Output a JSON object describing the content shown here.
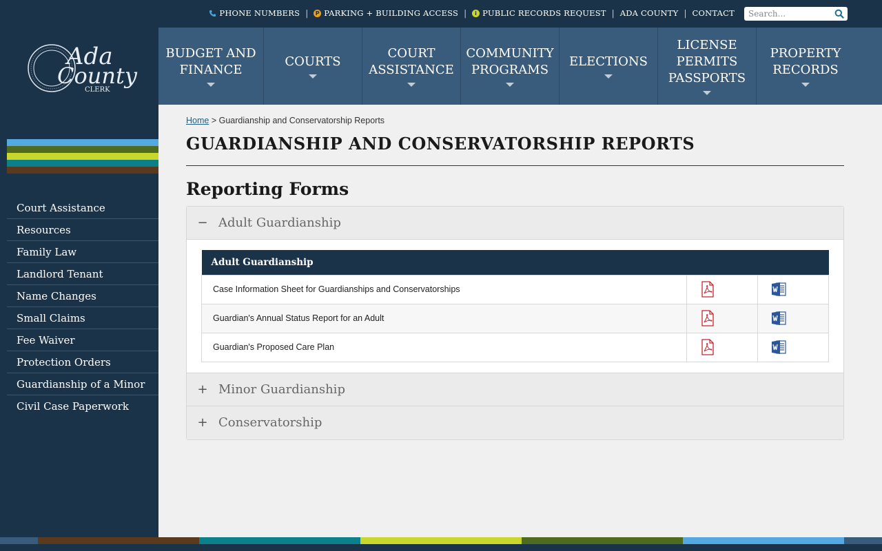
{
  "utility": {
    "phone": "PHONE NUMBERS",
    "parking": "PARKING + BUILDING ACCESS",
    "records": "PUBLIC RECORDS REQUEST",
    "county": "ADA COUNTY",
    "contact": "CONTACT",
    "sep": "|",
    "parking_icon": "P",
    "records_icon": "i"
  },
  "search": {
    "placeholder": "Search..."
  },
  "logo": {
    "line1": "Ada",
    "line2": "County",
    "line3": "CLERK"
  },
  "nav": [
    {
      "label": "BUDGET AND\nFINANCE"
    },
    {
      "label": "COURTS"
    },
    {
      "label": "COURT\nASSISTANCE"
    },
    {
      "label": "COMMUNITY\nPROGRAMS"
    },
    {
      "label": "ELECTIONS"
    },
    {
      "label": "LICENSE\nPERMITS\nPASSPORTS"
    },
    {
      "label": "PROPERTY\nRECORDS"
    }
  ],
  "sidebar": {
    "items": [
      "Court Assistance",
      "Resources",
      "Family Law",
      "Landlord Tenant",
      "Name Changes",
      "Small Claims",
      "Fee Waiver",
      "Protection Orders",
      "Guardianship of a Minor",
      "Civil Case Paperwork"
    ]
  },
  "breadcrumb": {
    "home": "Home",
    "separator": ">",
    "current": "Guardianship and Conservatorship Reports"
  },
  "page": {
    "title": "GUARDIANSHIP AND CONSERVATORSHIP REPORTS",
    "section": "Reporting Forms"
  },
  "accordion": {
    "open": {
      "toggle": "−",
      "title": "Adult Guardianship"
    },
    "table_header": "Adult Guardianship",
    "rows": [
      "Case Information Sheet for Guardianships and Conservatorships",
      "Guardian's Annual Status Report for an Adult",
      "Guardian's Proposed Care Plan"
    ],
    "closed": [
      {
        "toggle": "+",
        "title": "Minor Guardianship"
      },
      {
        "toggle": "+",
        "title": "Conservatorship"
      }
    ]
  },
  "icons": {
    "phone": "phone-icon",
    "parking": "parking-icon",
    "info": "info-icon",
    "search": "search-icon",
    "pdf": "pdf-icon",
    "word": "word-icon"
  },
  "colors": {
    "navy": "#1b3349",
    "nav_blue": "#3a5c7c",
    "stripe_sky": "#56a8e0",
    "stripe_olive": "#4e6b1f",
    "stripe_lime": "#c9d72c",
    "stripe_teal": "#0b7f8a",
    "stripe_brown": "#5a3a1e",
    "pdf_red": "#c8242c",
    "word_blue": "#2b579a"
  }
}
